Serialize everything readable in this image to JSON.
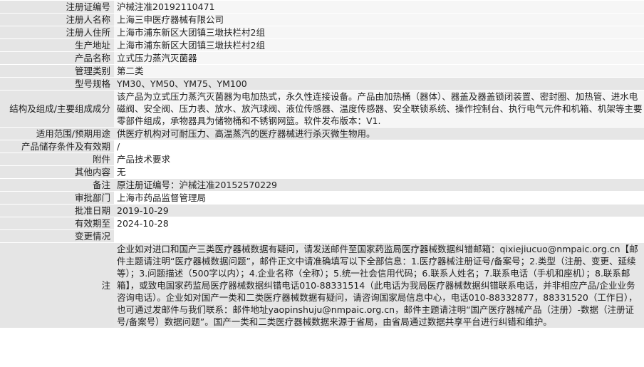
{
  "rows": [
    {
      "label": "注册证编号",
      "value": "沪械注准20192110471"
    },
    {
      "label": "注册人名称",
      "value": "上海三申医疗器械有限公司"
    },
    {
      "label": "注册人住所",
      "value": "上海市浦东新区大团镇三墩扶栏村2组"
    },
    {
      "label": "生产地址",
      "value": "上海市浦东新区大团镇三墩扶栏村2组"
    },
    {
      "label": "产品名称",
      "value": "立式压力蒸汽灭菌器"
    },
    {
      "label": "管理类别",
      "value": "第二类"
    },
    {
      "label": "型号规格",
      "value": "YM30、YM50、YM75、YM100"
    },
    {
      "label": "结构及组成/主要组成成分",
      "value": "该产品为立式压力蒸汽灭菌器为电加热式，永久性连接设备。产品由加热桶（器体）、器盖及器盖锁闭装置、密封圈、加热管、进水电磁阀、安全阀、压力表、放水、放汽球阀、液位传感器、温度传感器、安全联锁系统、操作控制台、执行电气元件和机箱、机架等主要零部件组成，承物器具为储物桶和不锈钢网篮。软件发布版本：V1."
    },
    {
      "label": "适用范围/预期用途",
      "value": "供医疗机构对可耐压力、高温蒸汽的医疗器械进行杀灭微生物用。"
    },
    {
      "label": "产品储存条件及有效期",
      "value": "/"
    },
    {
      "label": "附件",
      "value": "产品技术要求"
    },
    {
      "label": "其他内容",
      "value": "无"
    },
    {
      "label": "备注",
      "value": "原注册证编号：沪械注准20152570229"
    },
    {
      "label": "审批部门",
      "value": "上海市药品监督管理局"
    },
    {
      "label": "批准日期",
      "value": "2019-10-29"
    },
    {
      "label": "有效期至",
      "value": "2024-10-28"
    },
    {
      "label": "变更情况",
      "value": ""
    }
  ],
  "note": {
    "label": "注",
    "text": "企业如对进口和国产三类医疗器械数据有疑问，请发送邮件至国家药监局医疗器械数据纠错邮箱：qixiejiucuo@nmpaic.org.cn【邮件主题请注明“医疗器械数据问题”，邮件正文中请准确填写以下全部信息：1.医疗器械注册证号/备案号；2.类型（注册、变更、延续等）；3.问题描述（500字以内）；4.企业名称（全称）；5.统一社会信用代码；6.联系人姓名；7.联系电话（手机和座机）；8.联系邮箱】，或致电国家药监局医疗器械数据纠错电话010-88331514（此电话为我局医疗器械数据纠错联系电话，并非相应产品/企业业务咨询电话）。企业如对国产一类和二类医疗器械数据有疑问，请咨询国家局信息中心，电话010-88332877，88331520（工作日），也可通过发邮件与我们联系：邮件地址yaopinshuju@nmpaic.org.cn，邮件主题请注明“国产医疗器械产品（注册）-数据（注册证号/备案号）数据问题”。国产一类和二类医疗器械数据来源于省局，由省局通过数据共享平台进行纠错和维护。"
  }
}
